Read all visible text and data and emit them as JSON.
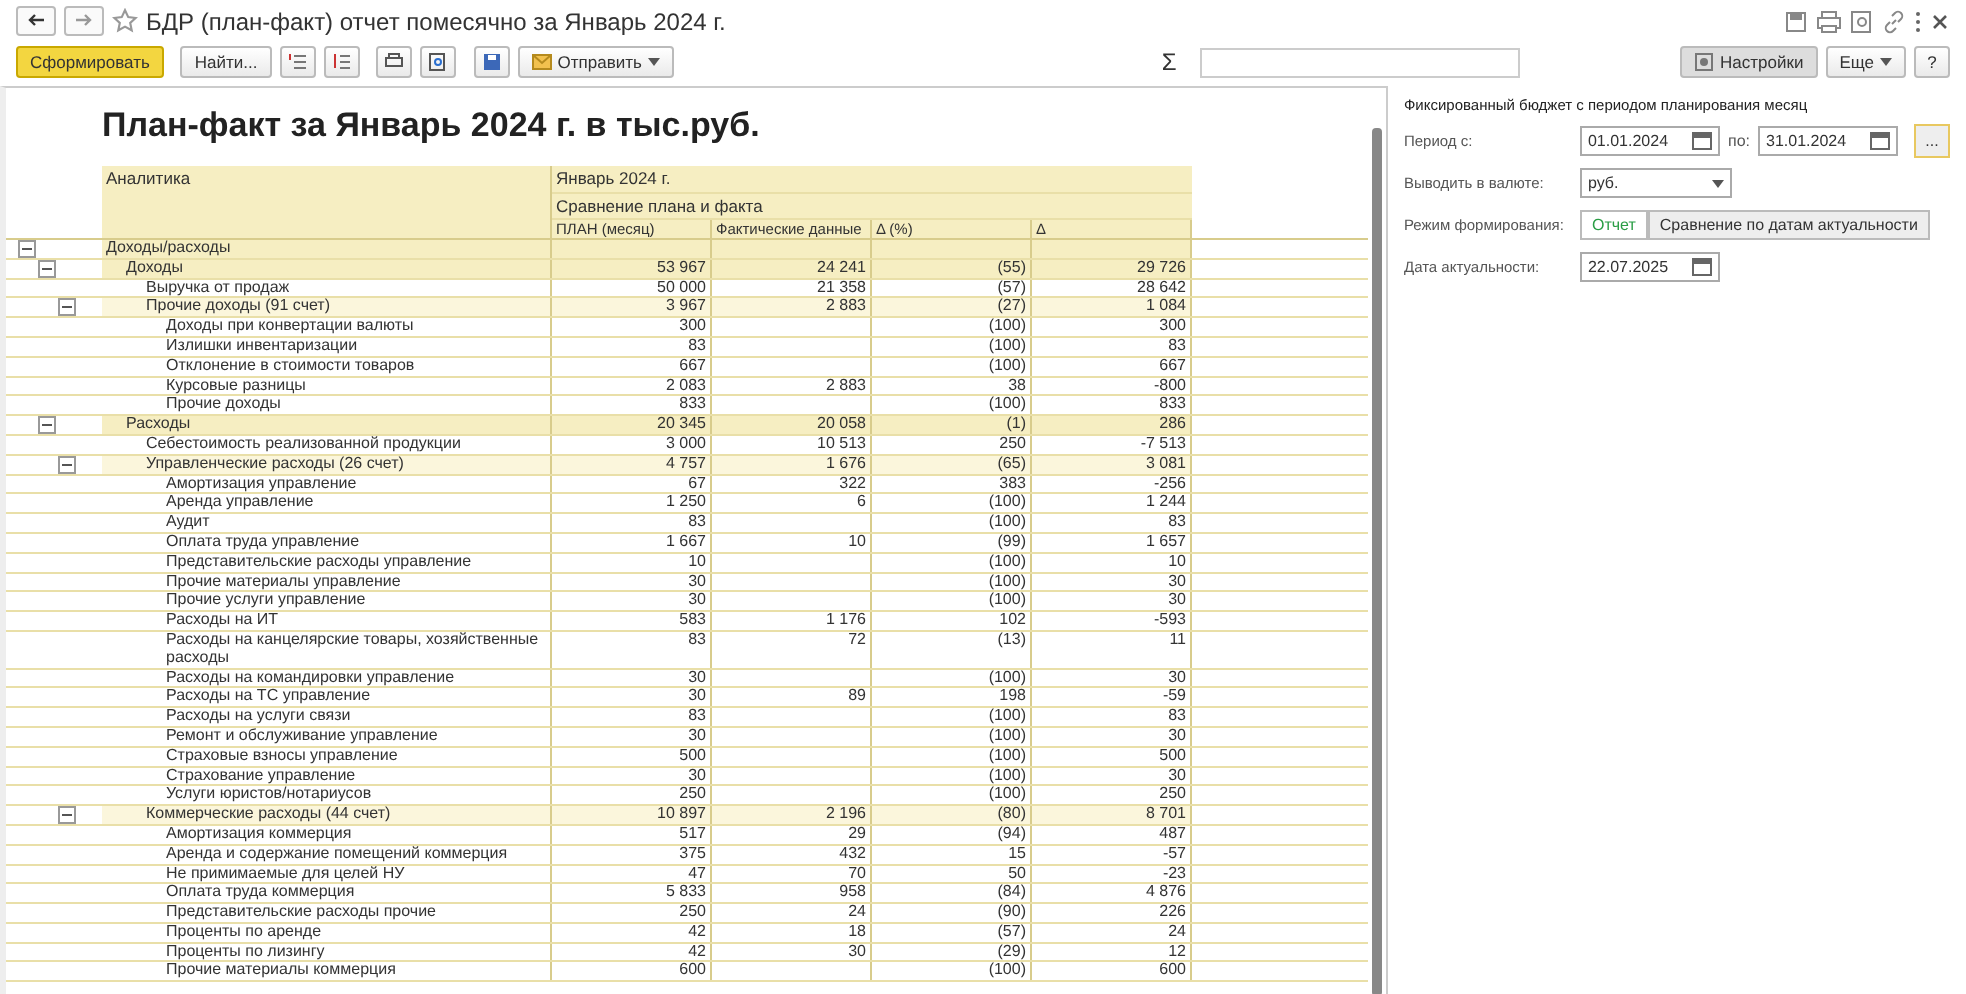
{
  "window": {
    "title": "БДР (план-факт) отчет помесячно  за Январь 2024 г."
  },
  "toolbar": {
    "generate": "Сформировать",
    "find": "Найти...",
    "send": "Отправить",
    "sum_sign": "Σ",
    "settings": "Настройки",
    "more": "Еще",
    "help": "?"
  },
  "report": {
    "title": "План-факт  за Январь 2024 г. в тыс.руб.",
    "header": {
      "analytics": "Аналитика",
      "period": "Январь 2024 г.",
      "group": "Сравнение плана и факта",
      "columns": [
        "ПЛАН (месяц)",
        "Фактические данные",
        "Δ (%)",
        "Δ"
      ]
    },
    "rows": [
      {
        "label": "Доходы/расходы",
        "expanded": true,
        "children": [
          {
            "label": "Доходы",
            "plan": "53 967",
            "fact": "24 241",
            "pct": "(55)",
            "delta": "29 726",
            "expanded": true,
            "children": [
              {
                "label": "Выручка от продаж",
                "plan": "50 000",
                "fact": "21 358",
                "pct": "(57)",
                "delta": "28 642"
              },
              {
                "label": "Прочие доходы (91 счет)",
                "plan": "3 967",
                "fact": "2 883",
                "pct": "(27)",
                "delta": "1 084",
                "expanded": true,
                "children": [
                  {
                    "label": "Доходы при конвертации валюты",
                    "plan": "300",
                    "pct": "(100)",
                    "delta": "300"
                  },
                  {
                    "label": "Излишки инвентаризации",
                    "plan": "83",
                    "pct": "(100)",
                    "delta": "83"
                  },
                  {
                    "label": "Отклонение в стоимости товаров",
                    "plan": "667",
                    "pct": "(100)",
                    "delta": "667"
                  },
                  {
                    "label": "Курсовые разницы",
                    "plan": "2 083",
                    "fact": "2 883",
                    "pct": "38",
                    "delta": "-800"
                  },
                  {
                    "label": "Прочие доходы",
                    "plan": "833",
                    "pct": "(100)",
                    "delta": "833"
                  }
                ]
              }
            ]
          },
          {
            "label": "Расходы",
            "plan": "20 345",
            "fact": "20 058",
            "pct": "(1)",
            "delta": "286",
            "expanded": true,
            "children": [
              {
                "label": "Себестоимость реализованной продукции",
                "plan": "3 000",
                "fact": "10 513",
                "pct": "250",
                "delta": "-7 513"
              },
              {
                "label": "Управленческие расходы (26 счет)",
                "plan": "4 757",
                "fact": "1 676",
                "pct": "(65)",
                "delta": "3 081",
                "expanded": true,
                "children": [
                  {
                    "label": "Амортизация управление",
                    "plan": "67",
                    "fact": "322",
                    "pct": "383",
                    "delta": "-256"
                  },
                  {
                    "label": "Аренда управление",
                    "plan": "1 250",
                    "fact": "6",
                    "pct": "(100)",
                    "delta": "1 244"
                  },
                  {
                    "label": "Аудит",
                    "plan": "83",
                    "pct": "(100)",
                    "delta": "83"
                  },
                  {
                    "label": "Оплата труда управление",
                    "plan": "1 667",
                    "fact": "10",
                    "pct": "(99)",
                    "delta": "1 657"
                  },
                  {
                    "label": "Представительские расходы управление",
                    "plan": "10",
                    "pct": "(100)",
                    "delta": "10"
                  },
                  {
                    "label": "Прочие материалы управление",
                    "plan": "30",
                    "pct": "(100)",
                    "delta": "30"
                  },
                  {
                    "label": "Прочие услуги управление",
                    "plan": "30",
                    "pct": "(100)",
                    "delta": "30"
                  },
                  {
                    "label": "Расходы на ИТ",
                    "plan": "583",
                    "fact": "1 176",
                    "pct": "102",
                    "delta": "-593"
                  },
                  {
                    "label": "Расходы на канцелярские товары, хозяйственные расходы",
                    "plan": "83",
                    "fact": "72",
                    "pct": "(13)",
                    "delta": "11"
                  },
                  {
                    "label": "Расходы на командировки управление",
                    "plan": "30",
                    "pct": "(100)",
                    "delta": "30"
                  },
                  {
                    "label": "Расходы на ТС управление",
                    "plan": "30",
                    "fact": "89",
                    "pct": "198",
                    "delta": "-59"
                  },
                  {
                    "label": "Расходы на услуги связи",
                    "plan": "83",
                    "pct": "(100)",
                    "delta": "83"
                  },
                  {
                    "label": "Ремонт и обслуживание управление",
                    "plan": "30",
                    "pct": "(100)",
                    "delta": "30"
                  },
                  {
                    "label": "Страховые взносы управление",
                    "plan": "500",
                    "pct": "(100)",
                    "delta": "500"
                  },
                  {
                    "label": "Страхование управление",
                    "plan": "30",
                    "pct": "(100)",
                    "delta": "30"
                  },
                  {
                    "label": "Услуги юристов/нотариусов",
                    "plan": "250",
                    "pct": "(100)",
                    "delta": "250"
                  }
                ]
              },
              {
                "label": "Коммерческие расходы (44 счет)",
                "plan": "10 897",
                "fact": "2 196",
                "pct": "(80)",
                "delta": "8 701",
                "expanded": true,
                "children": [
                  {
                    "label": "Амортизация коммерция",
                    "plan": "517",
                    "fact": "29",
                    "pct": "(94)",
                    "delta": "487"
                  },
                  {
                    "label": "Аренда и содержание помещений коммерция",
                    "plan": "375",
                    "fact": "432",
                    "pct": "15",
                    "delta": "-57"
                  },
                  {
                    "label": "Не примимаемые для целей НУ",
                    "plan": "47",
                    "fact": "70",
                    "pct": "50",
                    "delta": "-23"
                  },
                  {
                    "label": "Оплата труда коммерция",
                    "plan": "5 833",
                    "fact": "958",
                    "pct": "(84)",
                    "delta": "4 876"
                  },
                  {
                    "label": "Представительские расходы прочие",
                    "plan": "250",
                    "fact": "24",
                    "pct": "(90)",
                    "delta": "226"
                  },
                  {
                    "label": "Проценты по аренде",
                    "plan": "42",
                    "fact": "18",
                    "pct": "(57)",
                    "delta": "24"
                  },
                  {
                    "label": "Проценты по лизингу",
                    "plan": "42",
                    "fact": "30",
                    "pct": "(29)",
                    "delta": "12"
                  },
                  {
                    "label": "Прочие материалы коммерция",
                    "plan": "600",
                    "pct": "(100)",
                    "delta": "600"
                  }
                ]
              }
            ]
          }
        ]
      }
    ]
  },
  "settings_panel": {
    "title": "Фиксированный бюджет с периодом планирования месяц",
    "period_from": {
      "label": "Период с:",
      "value": "01.01.2024"
    },
    "period_to": {
      "label": "по:",
      "value": "31.01.2024"
    },
    "period_button": "...",
    "currency": {
      "label": "Выводить в валюте:",
      "value": "руб."
    },
    "mode": {
      "label": "Режим формирования:",
      "options": [
        {
          "label": "Отчет",
          "selected": true
        },
        {
          "label": "Сравнение по датам актуальности",
          "selected": false
        }
      ]
    },
    "actual_date": {
      "label": "Дата актуальности:",
      "value": "22.07.2025"
    }
  }
}
